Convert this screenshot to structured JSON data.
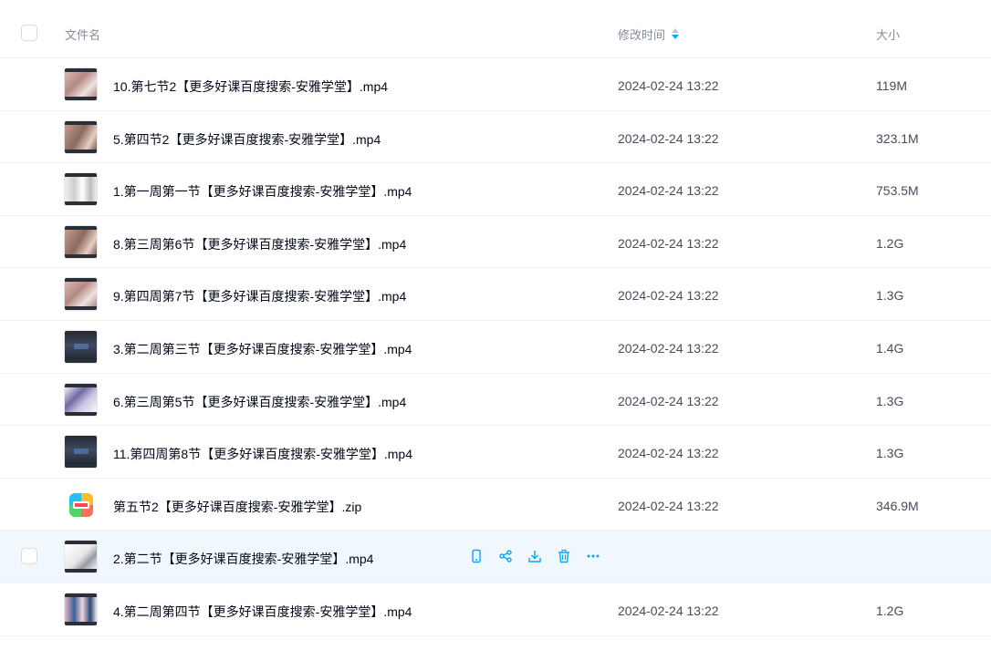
{
  "header": {
    "name_label": "文件名",
    "time_label": "修改时间",
    "size_label": "大小"
  },
  "files": [
    {
      "name": "10.第七节2【更多好课百度搜索-安雅学堂】.mp4",
      "time": "2024-02-24 13:22",
      "size": "119M",
      "thumb": "pink"
    },
    {
      "name": "5.第四节2【更多好课百度搜索-安雅学堂】.mp4",
      "time": "2024-02-24 13:22",
      "size": "323.1M",
      "thumb": "brown"
    },
    {
      "name": "1.第一周第一节【更多好课百度搜索-安雅学堂】.mp4",
      "time": "2024-02-24 13:22",
      "size": "753.5M",
      "thumb": "white"
    },
    {
      "name": "8.第三周第6节【更多好课百度搜索-安雅学堂】.mp4",
      "time": "2024-02-24 13:22",
      "size": "1.2G",
      "thumb": "brown"
    },
    {
      "name": "9.第四周第7节【更多好课百度搜索-安雅学堂】.mp4",
      "time": "2024-02-24 13:22",
      "size": "1.3G",
      "thumb": "pink"
    },
    {
      "name": "3.第二周第三节【更多好课百度搜索-安雅学堂】.mp4",
      "time": "2024-02-24 13:22",
      "size": "1.4G",
      "thumb": "dark"
    },
    {
      "name": "6.第三周第5节【更多好课百度搜索-安雅学堂】.mp4",
      "time": "2024-02-24 13:22",
      "size": "1.3G",
      "thumb": "purple"
    },
    {
      "name": "11.第四周第8节【更多好课百度搜索-安雅学堂】.mp4",
      "time": "2024-02-24 13:22",
      "size": "1.3G",
      "thumb": "dark"
    },
    {
      "name": "第五节2【更多好课百度搜索-安雅学堂】.zip",
      "time": "2024-02-24 13:22",
      "size": "346.9M",
      "thumb": "zip"
    },
    {
      "name": "2.第二节【更多好课百度搜索-安雅学堂】.mp4",
      "time": "",
      "size": "",
      "thumb": "light",
      "hover": true
    },
    {
      "name": "4.第二周第四节【更多好课百度搜索-安雅学堂】.mp4",
      "time": "2024-02-24 13:22",
      "size": "1.2G",
      "thumb": "multi"
    }
  ],
  "hover_actions": [
    "phone-icon",
    "share-icon",
    "download-icon",
    "delete-icon",
    "more-icon"
  ],
  "colors": {
    "accent": "#06a7ff",
    "hover_bg": "#f1f8fd"
  }
}
